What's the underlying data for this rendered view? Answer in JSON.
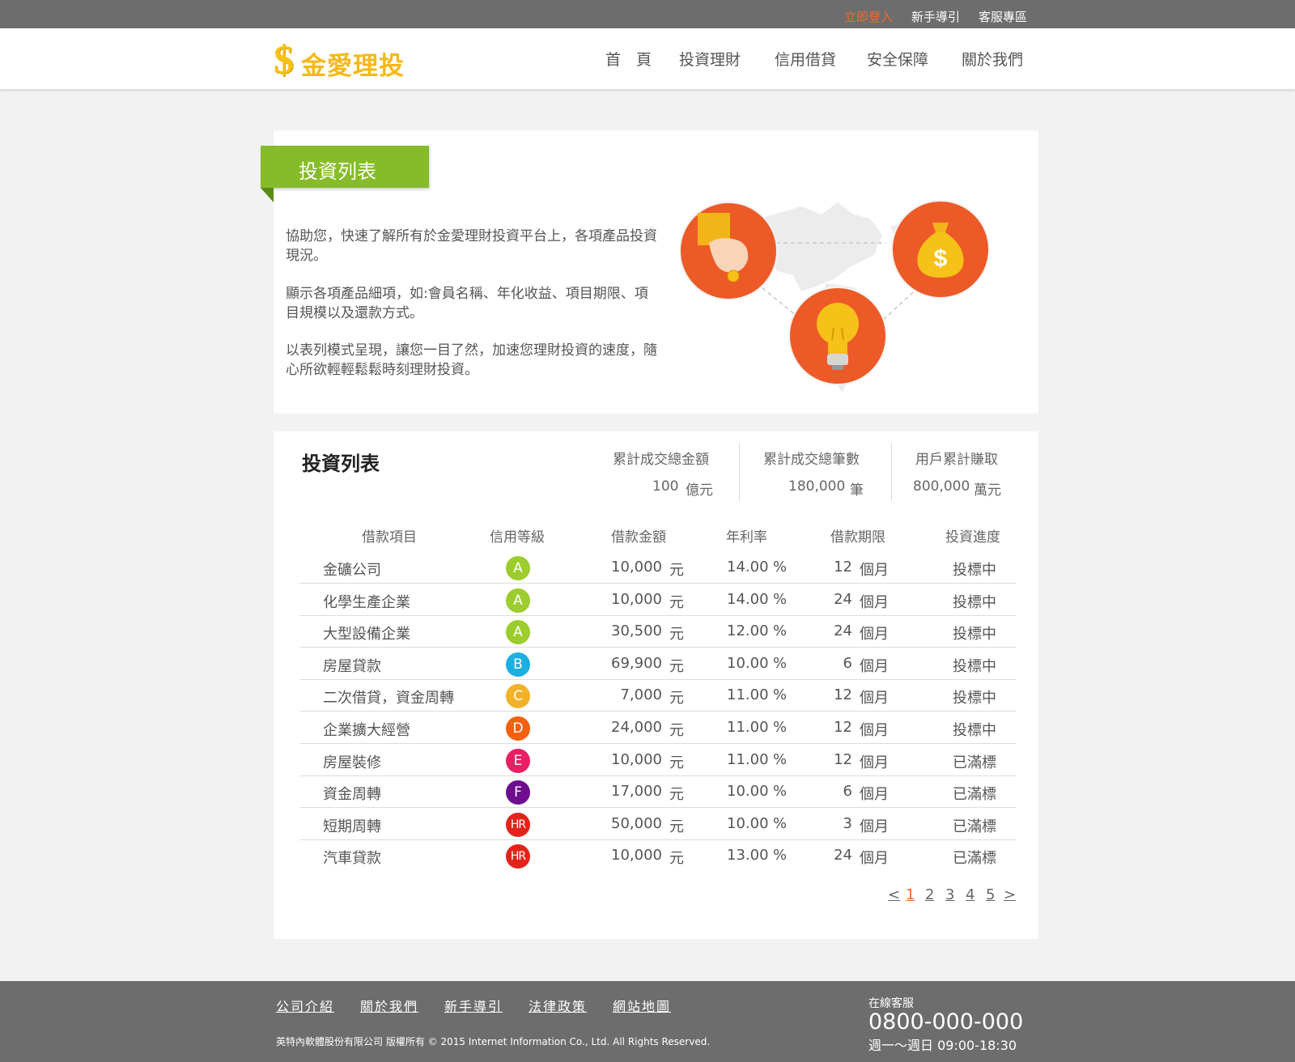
{
  "topbar": {
    "login": "立即登入",
    "guide": "新手導引",
    "service": "客服專區"
  },
  "header": {
    "logo_symbol": "$",
    "logo_name": "金愛理投",
    "nav": [
      "首　頁",
      "投資理財",
      "信用借貸",
      "安全保障",
      "關於我們"
    ]
  },
  "intro": {
    "ribbon": "投資列表",
    "paragraphs": [
      "協助您，快速了解所有於金愛理財投資平台上，各項產品投資現況。",
      "顯示各項產品細項，如:會員名稱、年化收益、項目期限、項目規模以及還款方式。",
      "以表列模式呈現，讓您一目了然，加速您理財投資的速度，隨心所欲輕輕鬆鬆時刻理財投資。"
    ]
  },
  "list": {
    "title": "投資列表",
    "stats": [
      {
        "label": "累計成交總金額",
        "value": "100",
        "unit": "億元"
      },
      {
        "label": "累計成交總筆數",
        "value": "180,000",
        "unit": "筆"
      },
      {
        "label": "用戶累計賺取",
        "value": "800,000",
        "unit": "萬元"
      }
    ],
    "headers": [
      "借款項目",
      "信用等級",
      "借款金額",
      "年利率",
      "借款期限",
      "投資進度"
    ],
    "rows": [
      {
        "name": "金礦公司",
        "grade": "A",
        "amount": "10,000",
        "amount_unit": "元",
        "rate": "14.00",
        "rate_unit": "%",
        "term": "12",
        "term_unit": "個月",
        "status": "投標中"
      },
      {
        "name": "化學生產企業",
        "grade": "A",
        "amount": "10,000",
        "amount_unit": "元",
        "rate": "14.00",
        "rate_unit": "%",
        "term": "24",
        "term_unit": "個月",
        "status": "投標中"
      },
      {
        "name": "大型設備企業",
        "grade": "A",
        "amount": "30,500",
        "amount_unit": "元",
        "rate": "12.00",
        "rate_unit": "%",
        "term": "24",
        "term_unit": "個月",
        "status": "投標中"
      },
      {
        "name": "房屋貸款",
        "grade": "B",
        "amount": "69,900",
        "amount_unit": "元",
        "rate": "10.00",
        "rate_unit": "%",
        "term": "6",
        "term_unit": "個月",
        "status": "投標中"
      },
      {
        "name": "二次借貸，資金周轉",
        "grade": "C",
        "amount": "7,000",
        "amount_unit": "元",
        "rate": "11.00",
        "rate_unit": "%",
        "term": "12",
        "term_unit": "個月",
        "status": "投標中"
      },
      {
        "name": "企業擴大經營",
        "grade": "D",
        "amount": "24,000",
        "amount_unit": "元",
        "rate": "11.00",
        "rate_unit": "%",
        "term": "12",
        "term_unit": "個月",
        "status": "投標中"
      },
      {
        "name": "房屋裝修",
        "grade": "E",
        "amount": "10,000",
        "amount_unit": "元",
        "rate": "11.00",
        "rate_unit": "%",
        "term": "12",
        "term_unit": "個月",
        "status": "已滿標"
      },
      {
        "name": "資金周轉",
        "grade": "F",
        "amount": "17,000",
        "amount_unit": "元",
        "rate": "10.00",
        "rate_unit": "%",
        "term": "6",
        "term_unit": "個月",
        "status": "已滿標"
      },
      {
        "name": "短期周轉",
        "grade": "HR",
        "amount": "50,000",
        "amount_unit": "元",
        "rate": "10.00",
        "rate_unit": "%",
        "term": "3",
        "term_unit": "個月",
        "status": "已滿標"
      },
      {
        "name": "汽車貸款",
        "grade": "HR",
        "amount": "10,000",
        "amount_unit": "元",
        "rate": "13.00",
        "rate_unit": "%",
        "term": "24",
        "term_unit": "個月",
        "status": "已滿標"
      }
    ],
    "grade_colors": {
      "A": "#9ccc2d",
      "B": "#1cb0e0",
      "C": "#f3b12a",
      "D": "#f3600f",
      "E": "#ea1f63",
      "F": "#6d0e8f",
      "HR": "#e3231a"
    },
    "pager": {
      "prev": "<",
      "pages": [
        "1",
        "2",
        "3",
        "4",
        "5"
      ],
      "current": "1",
      "next": ">"
    }
  },
  "footer": {
    "links": [
      "公司介紹",
      "關於我們",
      "新手導引",
      "法律政策",
      "網站地圖"
    ],
    "copyright": "英特內軟體股份有限公司 版權所有 © 2015 Internet Information Co., Ltd. All Rights Reserved.",
    "service_label": "在線客服",
    "phone": "0800-000-000",
    "hours": "週一～週日 09:00-18:30"
  },
  "colors": {
    "accent": "#f26a2d",
    "ribbon": "#86bb2a",
    "logo": "#f6b818",
    "topbar": "#6d6d6d"
  }
}
